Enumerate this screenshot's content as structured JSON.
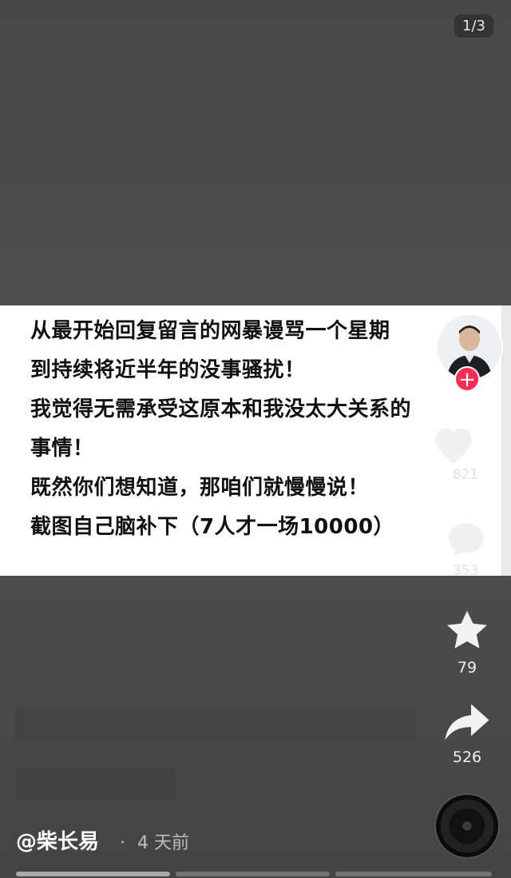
{
  "pagination": {
    "counter": "1/3"
  },
  "post_text": {
    "lines": [
      "从最开始回复留言的网暴谩骂一个星期",
      "到持续将近半年的没事骚扰！",
      "我觉得无需承受这原本和我没太大关系的",
      "事情！",
      "既然你们想知道，那咱们就慢慢说！",
      "截图自己脑补下（7人才一场10000）"
    ]
  },
  "sidebar": {
    "follow_label": "+",
    "like_count": "821",
    "comment_count": "353",
    "favorite_count": "79",
    "share_count": "526"
  },
  "footer": {
    "author": "@柴长易",
    "time_separator": "·",
    "time": "4 天前"
  },
  "colors": {
    "accent": "#fe2c55",
    "background": "#4a4a4a",
    "card": "#ffffff"
  },
  "icons": [
    "heart-icon",
    "comment-icon",
    "star-icon",
    "share-icon",
    "music-disc-icon"
  ]
}
